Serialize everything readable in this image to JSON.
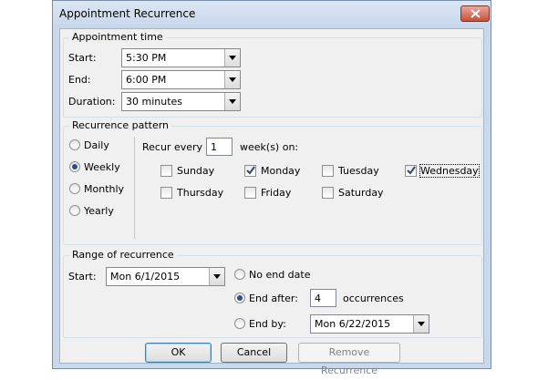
{
  "window": {
    "title": "Appointment Recurrence"
  },
  "appointment_time": {
    "group_label": "Appointment time",
    "start_label": "Start:",
    "start_value": "5:30 PM",
    "end_label": "End:",
    "end_value": "6:00 PM",
    "duration_label": "Duration:",
    "duration_value": "30 minutes"
  },
  "recurrence_pattern": {
    "group_label": "Recurrence pattern",
    "frequency_options": [
      {
        "label": "Daily",
        "selected": false
      },
      {
        "label": "Weekly",
        "selected": true
      },
      {
        "label": "Monthly",
        "selected": false
      },
      {
        "label": "Yearly",
        "selected": false
      }
    ],
    "recur_every_label": "Recur every",
    "recur_every_value": "1",
    "weeks_on_label": "week(s) on:",
    "days": [
      {
        "label": "Sunday",
        "checked": false
      },
      {
        "label": "Monday",
        "checked": true
      },
      {
        "label": "Tuesday",
        "checked": false
      },
      {
        "label": "Wednesday",
        "checked": true
      },
      {
        "label": "Thursday",
        "checked": false
      },
      {
        "label": "Friday",
        "checked": false
      },
      {
        "label": "Saturday",
        "checked": false
      }
    ]
  },
  "range": {
    "group_label": "Range of recurrence",
    "start_label": "Start:",
    "start_value": "Mon 6/1/2015",
    "no_end_label": "No end date",
    "end_after_label": "End after:",
    "end_after_value": "4",
    "occurrences_label": "occurrences",
    "end_by_label": "End by:",
    "end_by_value": "Mon 6/22/2015",
    "selected_option": "end_after"
  },
  "buttons": {
    "ok": "OK",
    "cancel": "Cancel",
    "remove": "Remove Recurrence"
  },
  "colors": {
    "title_bar": "#c9d8ea",
    "close_button": "#c7503a",
    "dialog_background": "#f0f0f0"
  }
}
